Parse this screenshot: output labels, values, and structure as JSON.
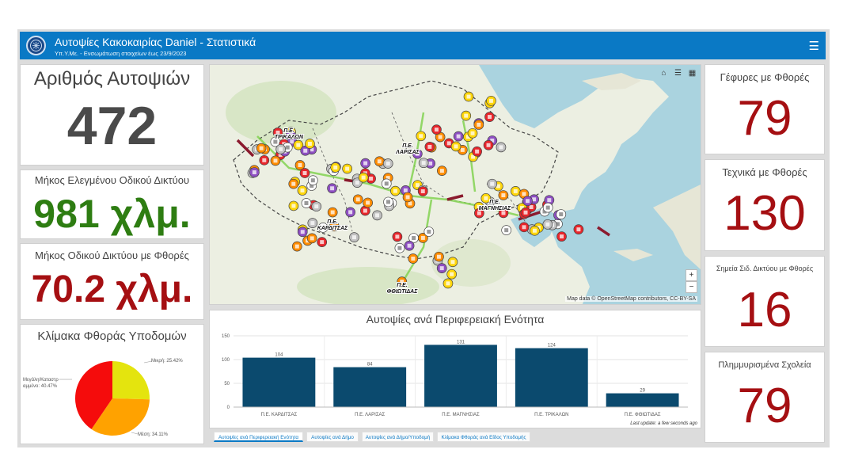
{
  "header": {
    "title": "Αυτοψίες Κακοκαιρίας Daniel - Στατιστικά",
    "subtitle": "Υπ.Υ.Με. - Ενσωμάτωση στοιχείων έως 23/9/2023"
  },
  "indicators": {
    "inspections": {
      "title": "Αριθμός Αυτοψιών",
      "value": "472",
      "color": "#4a4a4a"
    },
    "network_checked": {
      "title": "Μήκος Ελεγμένου Οδικού Δικτύου",
      "value": "981 χλμ.",
      "color": "#2e7d12"
    },
    "network_damaged": {
      "title": "Μήκος Οδικού Δικτύου με Φθορές",
      "value": "70.2 χλμ.",
      "color": "#a50f12"
    },
    "bridges": {
      "title": "Γέφυρες με Φθορές",
      "value": "79",
      "color": "#a50f12"
    },
    "technical": {
      "title": "Τεχνικά με Φθορές",
      "value": "130",
      "color": "#a50f12"
    },
    "rail_points": {
      "title": "Σημεία Σιδ. Δικτύου με Φθορές",
      "value": "16",
      "color": "#a50f12"
    },
    "schools": {
      "title": "Πλημμυρισμένα Σχολεία",
      "value": "79",
      "color": "#a50f12"
    }
  },
  "map": {
    "attribution": "Map data © OpenStreetMap contributors, CC-BY-SA",
    "zoom_in": "+",
    "zoom_out": "−",
    "labels": [
      "Π.Ε. ΤΡΙΚΑΛΩΝ",
      "Π.Ε. ΛΑΡΙΣΑΣ",
      "Π.Ε. ΚΑΡΔΙΤΣΑΣ",
      "Π.Ε. ΜΑΓΝΗΣΙΑΣ",
      "Π.Ε. ΦΘΙΩΤΙΔΑΣ"
    ]
  },
  "pie": {
    "title": "Κλίμακα Φθοράς Υποδομών",
    "labels": {
      "small": "Μικρή: 25.42%",
      "medium": "Μέση: 34.11%",
      "large_line1": "Μεγάλη/Καταστρ",
      "large_line2": "αμμένο: 40.47%"
    }
  },
  "chart_title": "Αυτοψίες ανά Περιφερειακή Ενότητα",
  "chart_update": "Last update: a few seconds ago",
  "chart_data": {
    "type": "bar",
    "title": "Αυτοψίες ανά Περιφερειακή Ενότητα",
    "categories": [
      "Π.Ε. ΚΑΡΔΙΤΣΑΣ",
      "Π.Ε. ΛΑΡΙΣΑΣ",
      "Π.Ε. ΜΑΓΝΗΣΙΑΣ",
      "Π.Ε. ΤΡΙΚΑΛΩΝ",
      "Π.Ε. ΦΘΙΩΤΙΔΑΣ"
    ],
    "values": [
      104,
      84,
      131,
      124,
      29
    ],
    "ylim": [
      0,
      150
    ],
    "yticks": [
      0,
      50,
      100,
      150
    ],
    "color": "#0b4a6e",
    "grid": true
  },
  "pie_data": {
    "type": "pie",
    "slices": [
      {
        "name": "Μικρή",
        "value": 25.42,
        "color": "#e4e40e"
      },
      {
        "name": "Μέση",
        "value": 34.11,
        "color": "#ffa200"
      },
      {
        "name": "Μεγάλη/Καταστραμμένο",
        "value": 40.47,
        "color": "#f50c0c"
      }
    ]
  },
  "tabs": [
    "Αυτοψίες ανά Περιφερειακή Ενότητα",
    "Αυτοψίες ανά Δήμο",
    "Αυτοψίες ανά Δήμο/Υποδομή",
    "Κλίμακα Φθοράς ανά Είδος Υποδομής"
  ]
}
